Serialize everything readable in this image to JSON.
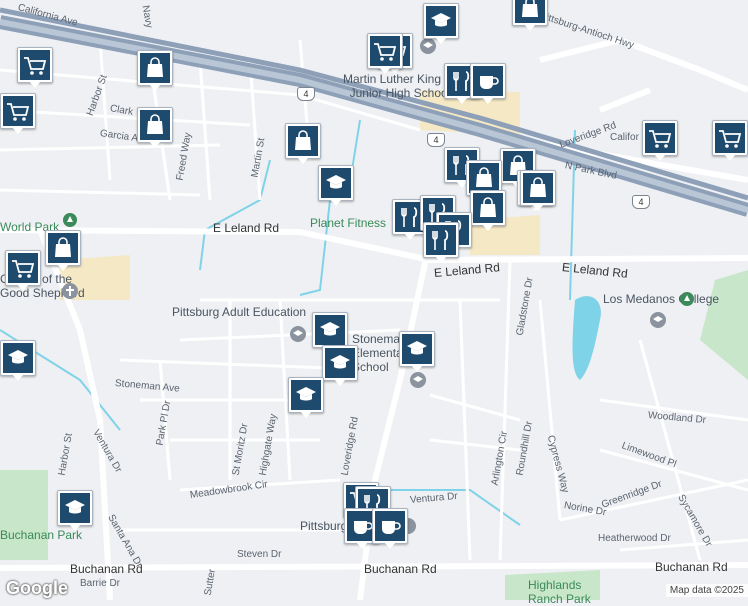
{
  "map": {
    "attribution": "Map data ©2025",
    "logo": "Google",
    "highway_shields": [
      "4",
      "4",
      "4"
    ],
    "streets": [
      "California Ave",
      "Navy",
      "Harbor St",
      "Clark",
      "Garcia Ave",
      "Freed Way",
      "Martin St",
      "E Leland Rd",
      "E Leland Rd",
      "E Leland Rd",
      "Stoneman Ave",
      "Park Pl Dr",
      "St Moritz Dr",
      "Highgate Way",
      "Meadowbrook Cir",
      "Ventura Dr",
      "Ventura Dr",
      "Santa Ana Dr",
      "Harbor St",
      "Steven Dr",
      "Buchanan Rd",
      "Buchanan Rd",
      "Buchanan Rd",
      "Barrie Dr",
      "Sutter",
      "Loveridge Rd",
      "N Park Blvd",
      "Pittsburg-Antioch Hwy",
      "Califor",
      "Gladstone Dr",
      "Arlington Cir",
      "Roundhill Dr",
      "Cypress Way",
      "Woodland Dr",
      "Limewood Pl",
      "Norine Dr",
      "Greenridge Dr",
      "Sycamore Dr",
      "Heatherwood Dr",
      "Loveridge Rd"
    ],
    "pois": [
      {
        "label": "Martin Luther King Jr. Junior High School",
        "icon": "school-icon"
      },
      {
        "label": "Planet Fitness",
        "icon": "gym-icon"
      },
      {
        "label": "World Park",
        "icon": "park-icon"
      },
      {
        "label": "Church of the Good Shepherd",
        "icon": "church-icon"
      },
      {
        "label": "Pittsburg Adult Education",
        "icon": "school-icon"
      },
      {
        "label": "Stoneman Elementary School",
        "icon": "school-icon"
      },
      {
        "label": "Los Medanos College",
        "icon": "school-icon"
      },
      {
        "label": "Buchanan Park",
        "icon": "park-icon"
      },
      {
        "label": "Pittsburg",
        "icon": "place-icon"
      },
      {
        "label": "Highlands Ranch Park",
        "icon": "park-icon"
      }
    ],
    "markers": [
      "school-icon",
      "shopping-bag-icon",
      "cart-icon",
      "cart-icon",
      "food-icon",
      "coffee-icon",
      "cart-icon",
      "cart-icon",
      "shopping-bag-icon",
      "shopping-bag-icon",
      "cart-icon",
      "shopping-bag-icon",
      "school-icon",
      "food-icon",
      "shopping-bag-icon",
      "shopping-bag-icon",
      "cart-icon",
      "shopping-bag-icon",
      "food-icon",
      "shopping-bag-icon",
      "food-icon",
      "food-icon",
      "food-icon",
      "shopping-bag-icon",
      "cart-icon",
      "shopping-bag-icon",
      "school-icon",
      "school-icon",
      "school-icon",
      "school-icon",
      "school-icon",
      "school-icon",
      "cart-icon",
      "food-icon",
      "coffee-icon",
      "coffee-icon"
    ],
    "colors": {
      "background": "#eef0f3",
      "road": "#ffffff",
      "highway": "#8da0b8",
      "water": "#7fd3e8",
      "park": "#c8e6c9",
      "sand": "#f5e8c4",
      "marker": "#1e4a6e"
    }
  }
}
